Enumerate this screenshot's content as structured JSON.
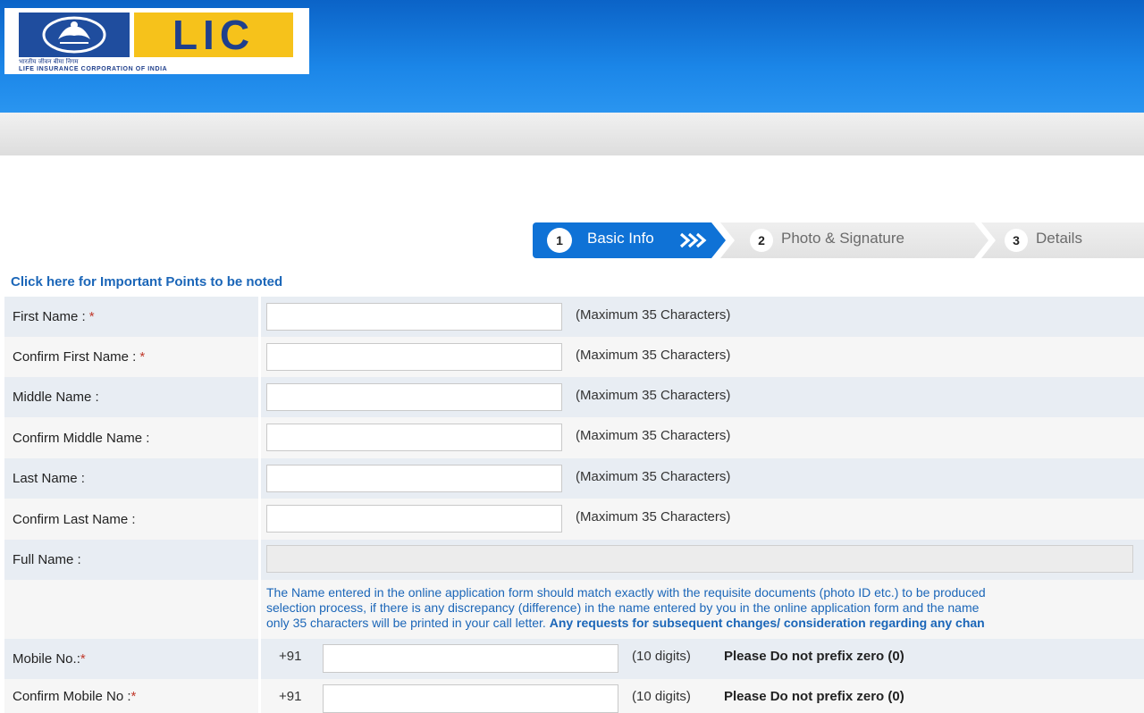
{
  "header": {
    "logo_text": "LIC",
    "logo_hindi": "भारतीय जीवन बीमा निगम",
    "logo_subtitle": "LIFE INSURANCE CORPORATION OF INDIA",
    "colors": {
      "header_blue": "#1b86e8",
      "logo_yellow": "#f6c21b",
      "logo_navy": "#1f4d9e"
    }
  },
  "steps": [
    {
      "number": "1",
      "label": "Basic Info",
      "active": true
    },
    {
      "number": "2",
      "label": "Photo & Signature",
      "active": false
    },
    {
      "number": "3",
      "label": "Details",
      "active": false
    }
  ],
  "important_link": "Click here for Important Points to be noted",
  "form": {
    "rows": [
      {
        "label": "First Name :",
        "required": "*",
        "hint": "(Maximum 35 Characters)",
        "value": ""
      },
      {
        "label": "Confirm First Name :",
        "required": "*",
        "hint": "(Maximum 35 Characters)",
        "value": ""
      },
      {
        "label": "Middle Name :",
        "required": "",
        "hint": "(Maximum 35 Characters)",
        "value": ""
      },
      {
        "label": "Confirm Middle Name :",
        "required": "",
        "hint": "(Maximum 35 Characters)",
        "value": ""
      },
      {
        "label": "Last Name :",
        "required": "",
        "hint": "(Maximum 35 Characters)",
        "value": ""
      },
      {
        "label": "Confirm Last Name :",
        "required": "",
        "hint": "(Maximum 35 Characters)",
        "value": ""
      }
    ],
    "full_name": {
      "label": "Full Name :",
      "value": ""
    },
    "note": {
      "line1": "The Name entered in the online application form should match exactly with the requisite documents (photo ID etc.) to be produced",
      "line2": "selection process, if there is any discrepancy (difference) in the name entered by you in the online application form and the name",
      "line3_normal": "only 35 characters will be printed in your call letter.",
      "line3_bold": "Any requests for subsequent changes/ consideration regarding any chan"
    },
    "mobile": {
      "label": "Mobile No.:",
      "required": "*",
      "country_code": "+91",
      "digits_hint": "(10 digits)",
      "warning": "Please Do not prefix zero (0)",
      "value": ""
    },
    "confirm_mobile": {
      "label": "Confirm Mobile No :",
      "required": "*",
      "country_code": "+91",
      "digits_hint": "(10 digits)",
      "warning": "Please Do not prefix zero (0)",
      "value": ""
    }
  }
}
